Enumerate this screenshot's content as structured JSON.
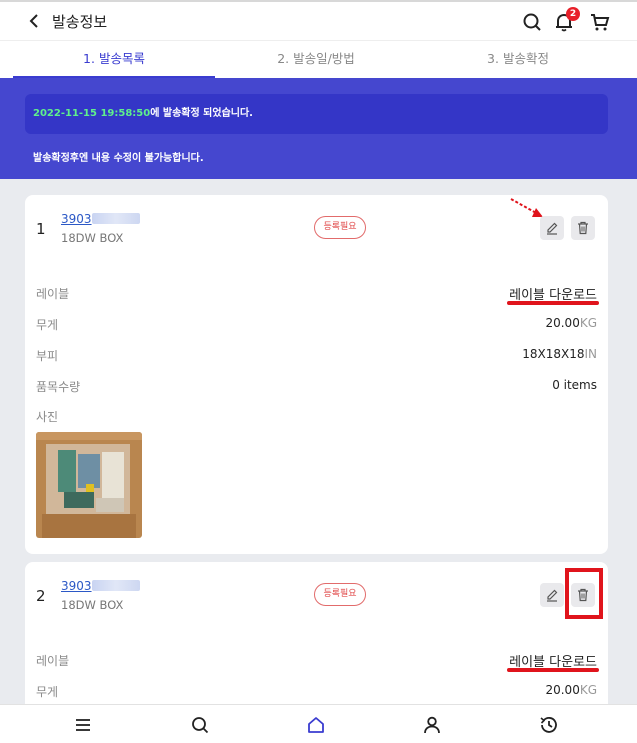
{
  "header": {
    "title": "발송정보",
    "cart_badge": "2"
  },
  "tabs": [
    {
      "label": "1. 발송목록"
    },
    {
      "label": "2. 발송일/방법"
    },
    {
      "label": "3. 발송확정"
    }
  ],
  "banner": {
    "timestamp": "2022-11-15 19:58:50",
    "confirm_text": "에 발송확정 되었습니다.",
    "note": "발송확정후엔 내용 수정이 불가능합니다."
  },
  "items": [
    {
      "index": "1",
      "code_prefix": "3903",
      "box": "18DW BOX",
      "status": "등록필요",
      "label_title": "레이블",
      "label_link": "레이블 다운로드",
      "weight_title": "무게",
      "weight_value": "20.00",
      "weight_unit": "KG",
      "volume_title": "부피",
      "volume_value": "18X18X18",
      "volume_unit": "IN",
      "qty_title": "품목수량",
      "qty_value": "0 items",
      "photo_title": "사진"
    },
    {
      "index": "2",
      "code_prefix": "3903",
      "box": "18DW BOX",
      "status": "등록필요",
      "label_title": "레이블",
      "label_link": "레이블 다운로드",
      "weight_title": "무게",
      "weight_value": "20.00",
      "weight_unit": "KG"
    }
  ],
  "icons": {
    "back": "chevron-left-icon",
    "search": "search-icon",
    "notifications": "bell-icon",
    "cart": "cart-icon",
    "edit": "pencil-icon",
    "delete": "trash-icon",
    "menu": "menu-icon",
    "home": "home-icon",
    "user": "user-icon",
    "history": "history-icon"
  },
  "colors": {
    "accent": "#3a3cd0",
    "banner": "#4547cf",
    "timestamp": "#5ff08c",
    "status": "#e04848",
    "annotation": "#e0141c"
  }
}
